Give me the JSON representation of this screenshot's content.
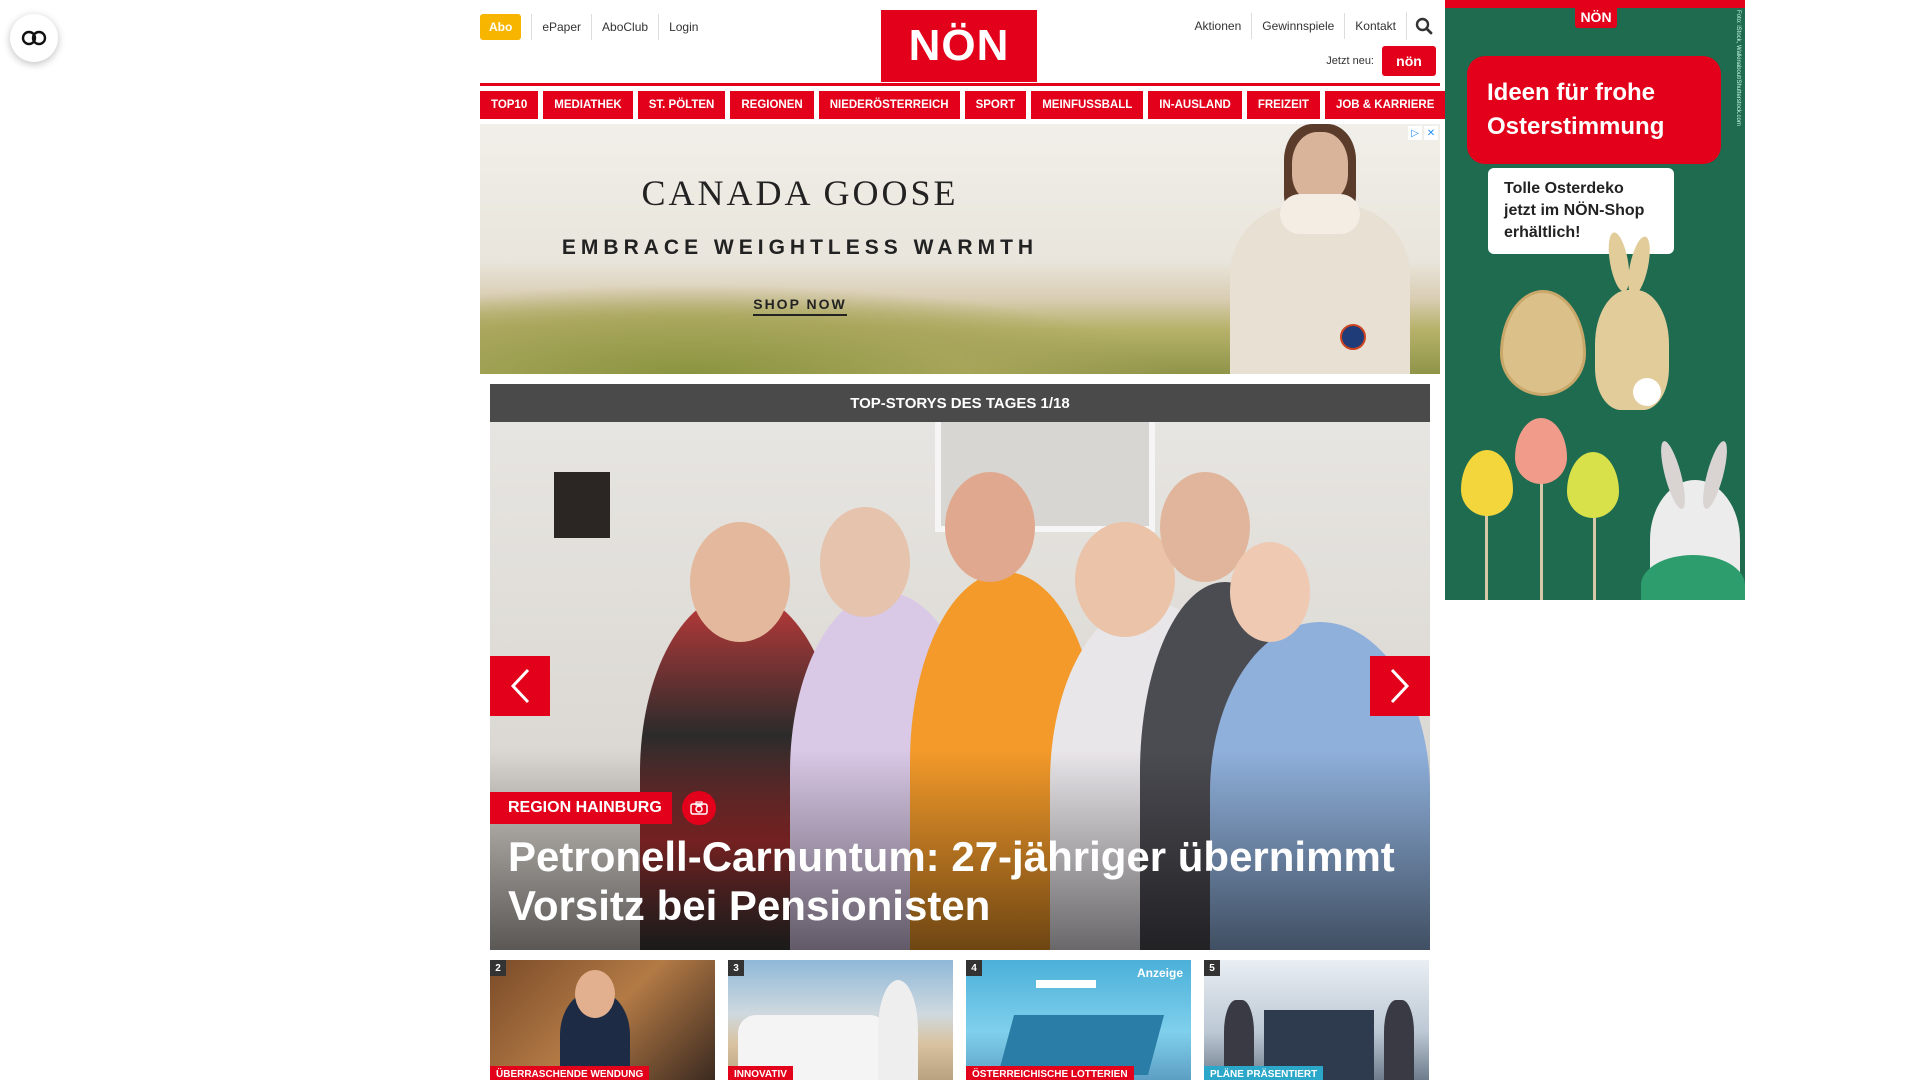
{
  "header": {
    "abo": "Abo",
    "left_links": [
      "ePaper",
      "AboClub",
      "Login"
    ],
    "logo": "NÖN",
    "right_links": [
      "Aktionen",
      "Gewinnspiele",
      "Kontakt"
    ],
    "new_label": "Jetzt neu:",
    "new_badge": "nön"
  },
  "nav": [
    "TOP10",
    "MEDIATHEK",
    "ST. PÖLTEN",
    "REGIONEN",
    "NIEDERÖSTERREICH",
    "SPORT",
    "MEINFUSSBALL",
    "IN-AUSLAND",
    "FREIZEIT",
    "JOB & KARRIERE"
  ],
  "ad_banner": {
    "brand": "CANADA GOOSE",
    "tagline": "EMBRACE WEIGHTLESS WARMTH",
    "cta": "SHOP NOW"
  },
  "stories": {
    "heading": "TOP-STORYS DES TAGES 1/18",
    "hero": {
      "category": "REGION HAINBURG",
      "title": "Petronell-Carnuntum: 27-jähriger übernimmt Vorsitz bei Pensionisten"
    },
    "thumbs": [
      {
        "num": "2",
        "category": "ÜBERRASCHENDE WENDUNG",
        "ad": ""
      },
      {
        "num": "3",
        "category": "INNOVATIV",
        "ad": ""
      },
      {
        "num": "4",
        "category": "ÖSTERREICHISCHE LOTTERIEN",
        "ad": "Anzeige"
      },
      {
        "num": "5",
        "category": "PLÄNE PRÄSENTIERT",
        "ad": ""
      }
    ]
  },
  "side_ad": {
    "logo": "NÖN",
    "headline": "Ideen für frohe Osterstimmung",
    "sub": "Tolle Osterdeko jetzt im NÖN-Shop erhältlich!",
    "credit": "Foto: iStock, Walkinabout/Shutterstock.com"
  },
  "icons": {
    "accessibility": "accessibility-icon",
    "search": "search-icon",
    "camera": "camera-icon",
    "prev": "chevron-left-icon",
    "next": "chevron-right-icon"
  },
  "colors": {
    "brand_red": "#e2001a",
    "abo_yellow": "#f7b500",
    "bar_gray": "#4a4a4a",
    "ad_green": "#1f6b50"
  }
}
